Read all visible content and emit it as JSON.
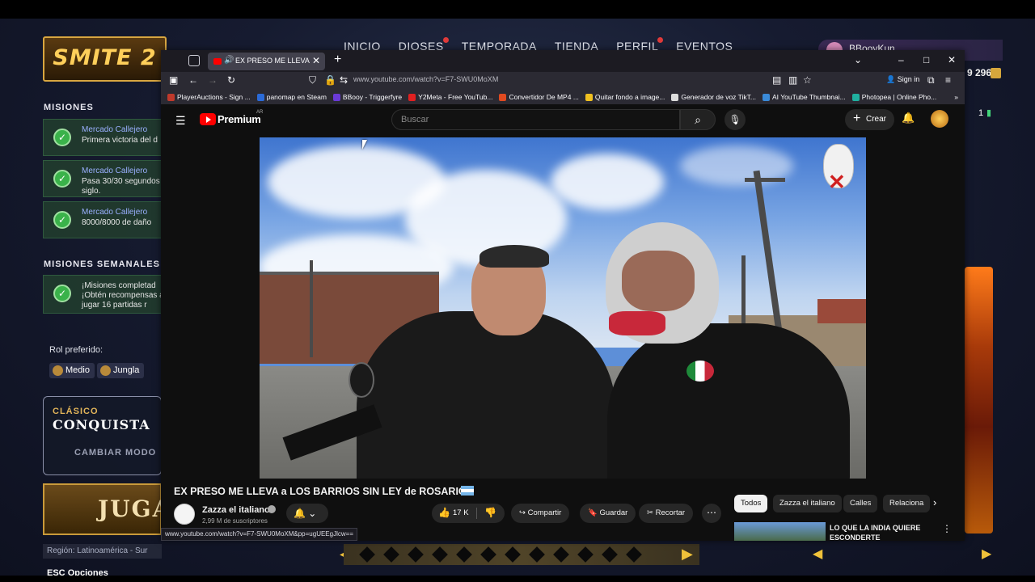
{
  "game": {
    "logo": "SMITE 2",
    "nav": [
      "INICIO",
      "DIOSES",
      "TEMPORADA",
      "TIENDA",
      "PERFIL",
      "EVENTOS"
    ],
    "username": "BBooyKun",
    "currency": "9 296",
    "side_count": "1",
    "missions_title": "MISIONES",
    "missions": [
      {
        "title": "Mercado Callejero",
        "desc": "Primera victoria del d"
      },
      {
        "title": "Mercado Callejero",
        "desc": "Pasa 30/30 segundos siglo."
      },
      {
        "title": "Mercado Callejero",
        "desc": "8000/8000 de daño"
      }
    ],
    "weekly_title": "MISIONES SEMANALES",
    "weekly": {
      "desc": "¡Misiones completad ¡Obtén recompensas al jugar 16 partidas r"
    },
    "role_label": "Rol preferido:",
    "roles": [
      "Medio",
      "Jungla"
    ],
    "mode_small": "CLÁSICO",
    "mode_big": "CONQUISTA",
    "change_mode": "CAMBIAR MODO",
    "play": "JUGA",
    "region": "Región: Latinoamérica - Sur",
    "esc_label": "ESC",
    "options_label": "Opciones"
  },
  "browser": {
    "tab_title": "EX PRESO ME LLEVA a LOS",
    "url": "www.youtube.com/watch?v=F7-SWU0MoXM",
    "sign_in": "Sign in",
    "bookmarks": [
      {
        "label": "PlayerAuctions - Sign ...",
        "color": "#c0392b"
      },
      {
        "label": "panomap en Steam",
        "color": "#2a6ad8"
      },
      {
        "label": "BBooy - Triggerfyre",
        "color": "#6a3ad8"
      },
      {
        "label": "Y2Meta - Free YouTub...",
        "color": "#e02020"
      },
      {
        "label": "Convertidor De MP4 ...",
        "color": "#e04a20"
      },
      {
        "label": "Quitar fondo a image...",
        "color": "#f0c020"
      },
      {
        "label": "Generador de voz TikT...",
        "color": "#dddddd"
      },
      {
        "label": "AI YouTube Thumbnai...",
        "color": "#3a8ad8"
      },
      {
        "label": "Photopea | Online Pho...",
        "color": "#20b0a0"
      }
    ],
    "status_url": "www.youtube.com/watch?v=F7-SWU0MoXM&pp=ugUEEgJlcw=="
  },
  "youtube": {
    "brand": "Premium",
    "region_tag": "AR",
    "search_placeholder": "Buscar",
    "create_label": "Crear",
    "video_title": "EX PRESO ME LLEVA a LOS BARRIOS SIN LEY de ROSARIO",
    "channel": "Zazza el italiano",
    "subscribers": "2,99 M de suscriptores",
    "likes": "17 K",
    "share": "Compartir",
    "save": "Guardar",
    "clip": "Recortar",
    "chips": [
      "Todos",
      "Zazza el italiano",
      "Calles",
      "Relaciona"
    ],
    "rec_title": "LO QUE LA INDIA QUIERE ESCONDERTE"
  }
}
